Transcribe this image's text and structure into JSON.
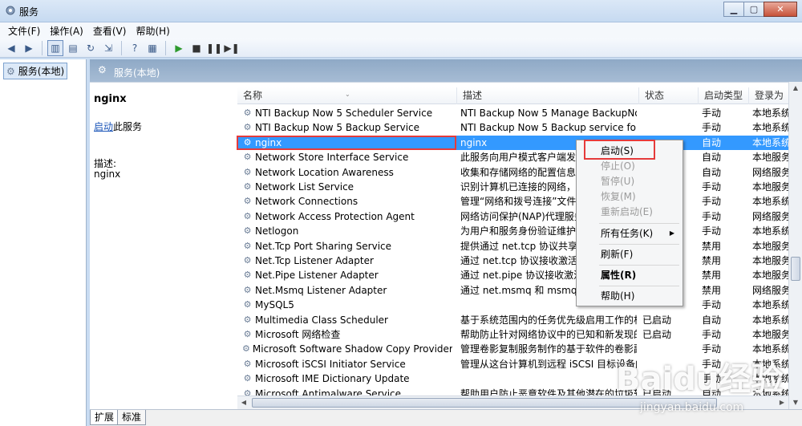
{
  "window": {
    "title": "服务",
    "min": "0",
    "max": "1",
    "close": "r"
  },
  "menu": [
    "文件(F)",
    "操作(A)",
    "查看(V)",
    "帮助(H)"
  ],
  "tree": {
    "root": "服务(本地)"
  },
  "header": {
    "label": "服务(本地)"
  },
  "detail": {
    "name": "nginx",
    "start_link": "启动",
    "start_suffix": "此服务",
    "desc_label": "描述:",
    "desc_value": "nginx"
  },
  "columns": [
    "名称",
    "描述",
    "状态",
    "启动类型",
    "登录为"
  ],
  "rows": [
    {
      "name": "NTI Backup Now 5 Scheduler Service",
      "desc": "NTI Backup Now 5 Manage BackupNow...",
      "status": "",
      "stype": "手动",
      "logon": "本地系统"
    },
    {
      "name": "NTI Backup Now 5 Backup Service",
      "desc": "NTI Backup Now 5 Backup service for b...",
      "status": "",
      "stype": "手动",
      "logon": "本地系统"
    },
    {
      "name": "nginx",
      "desc": "nginx",
      "status": "",
      "stype": "自动",
      "logon": "本地系统"
    },
    {
      "name": "Network Store Interface Service",
      "desc": "此服务向用户模式客户端发送网",
      "status": "",
      "stype": "自动",
      "logon": "本地服务"
    },
    {
      "name": "Network Location Awareness",
      "desc": "收集和存储网络的配置信息，并",
      "status": "",
      "stype": "自动",
      "logon": "网络服务"
    },
    {
      "name": "Network List Service",
      "desc": "识别计算机已连接的网络，收集",
      "status": "",
      "stype": "手动",
      "logon": "本地服务"
    },
    {
      "name": "Network Connections",
      "desc": "管理“网络和拨号连接”文件夹",
      "status": "",
      "stype": "手动",
      "logon": "本地系统"
    },
    {
      "name": "Network Access Protection Agent",
      "desc": "网络访问保护(NAP)代理服务收",
      "status": "",
      "stype": "手动",
      "logon": "网络服务"
    },
    {
      "name": "Netlogon",
      "desc": "为用户和服务身份验证维护此计",
      "status": "",
      "stype": "手动",
      "logon": "本地系统"
    },
    {
      "name": "Net.Tcp Port Sharing Service",
      "desc": "提供通过 net.tcp 协议共享 TC",
      "status": "",
      "stype": "禁用",
      "logon": "本地服务"
    },
    {
      "name": "Net.Tcp Listener Adapter",
      "desc": "通过 net.tcp 协议接收激活请求",
      "status": "",
      "stype": "禁用",
      "logon": "本地服务"
    },
    {
      "name": "Net.Pipe Listener Adapter",
      "desc": "通过 net.pipe 协议接收激活请",
      "status": "",
      "stype": "禁用",
      "logon": "本地服务"
    },
    {
      "name": "Net.Msmq Listener Adapter",
      "desc": "通过 net.msmq 和 msmq.forn",
      "status": "",
      "stype": "禁用",
      "logon": "网络服务"
    },
    {
      "name": "MySQL5",
      "desc": "",
      "status": "",
      "stype": "手动",
      "logon": "本地系统"
    },
    {
      "name": "Multimedia Class Scheduler",
      "desc": "基于系统范围内的任务优先级启用工作的相...",
      "status": "已启动",
      "stype": "自动",
      "logon": "本地系统"
    },
    {
      "name": "Microsoft 网络检查",
      "desc": "帮助防止针对网络协议中的已知和新发现的...",
      "status": "已启动",
      "stype": "手动",
      "logon": "本地服务"
    },
    {
      "name": "Microsoft Software Shadow Copy Provider",
      "desc": "管理卷影复制服务制作的基于软件的卷影副...",
      "status": "",
      "stype": "手动",
      "logon": "本地系统"
    },
    {
      "name": "Microsoft iSCSI Initiator Service",
      "desc": "管理从这台计算机到远程 iSCSI 目标设备的...",
      "status": "",
      "stype": "手动",
      "logon": "本地系统"
    },
    {
      "name": "Microsoft IME Dictionary Update",
      "desc": "",
      "status": "",
      "stype": "手动",
      "logon": "本地系统"
    },
    {
      "name": "Microsoft Antimalware Service",
      "desc": "帮助用户防止恶意软件及其他潜在的垃圾软...",
      "status": "已启动",
      "stype": "自动",
      "logon": "本地系统"
    }
  ],
  "context_menu": {
    "start": "启动(S)",
    "stop": "停止(O)",
    "pause": "暂停(U)",
    "resume": "恢复(M)",
    "restart": "重新启动(E)",
    "all_tasks": "所有任务(K)",
    "refresh": "刷新(F)",
    "properties": "属性(R)",
    "help": "帮助(H)"
  },
  "tabs": [
    "扩展",
    "标准"
  ],
  "watermark": {
    "logo": "Baidu经验",
    "url": "jingyan.baidu.com"
  },
  "colors": {
    "selection": "#3399ff",
    "highlight_box": "#e53b3b",
    "header_band": "#98b0cb"
  }
}
